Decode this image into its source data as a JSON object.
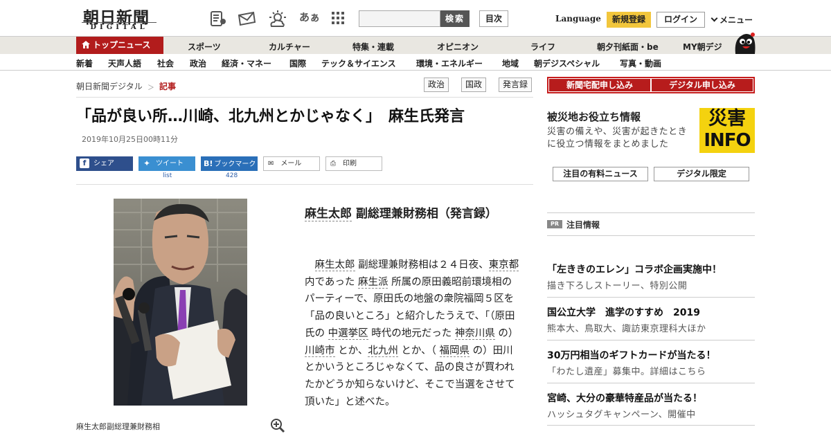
{
  "header": {
    "logo_main": "朝日新聞",
    "logo_sub": "DIGITAL",
    "icons": [
      "newspaper-icon",
      "mail-icon",
      "weather-icon",
      "font-size-icon",
      "grid-menu-icon"
    ],
    "font_size_label": "あぁ",
    "search_placeholder": "",
    "search_button": "検索",
    "toc_button": "目次",
    "language": "Language",
    "register": "新規登録",
    "login": "ログイン",
    "menu": "メニュー"
  },
  "nav1": {
    "top_news": "トップニュース",
    "items": [
      "スポーツ",
      "カルチャー",
      "特集・連載",
      "オピニオン",
      "ライフ",
      "朝夕刊紙面・be",
      "MY朝デジ"
    ]
  },
  "nav2": {
    "items": [
      "新着",
      "天声人語",
      "社会",
      "政治",
      "経済・マネー",
      "国際",
      "テック＆サイエンス",
      "環境・エネルギー",
      "地域",
      "朝デジスペシャル",
      "写真・動画"
    ]
  },
  "breadcrumb": {
    "home": "朝日新聞デジタル",
    "sep": "＞",
    "current": "記事"
  },
  "tags": [
    "政治",
    "国政",
    "発言録"
  ],
  "article": {
    "title": "「品が良い所…川崎、北九州とかじゃなく」　麻生氏発言",
    "date": "2019年10月25日00時11分",
    "share": {
      "facebook": "シェア",
      "twitter": "ツイート",
      "hatena": "ブックマーク",
      "hatena_icon": "B!",
      "mail": "メール",
      "print": "印刷",
      "twitter_count": "list",
      "hatena_count": "428"
    },
    "caption": "麻生太郎副総理兼財務相",
    "lead_name": "麻生太郎",
    "lead_rest": " 副総理兼財務相（発言録）",
    "body": {
      "s1": "麻生太郎",
      "s2": " 副総理兼財務相は２４日夜、",
      "s3": "東京都",
      "s4": " 内であった ",
      "s5": "麻生派",
      "s6": " 所属の原田義昭前環境相のパーティーで、原田氏の地盤の衆院福岡５区を「品の良いところ」と紹介したうえで、「（原田氏の ",
      "s7": "中選挙区",
      "s8": " 時代の地元だった ",
      "s9": "神奈川県",
      "s10": " の） ",
      "s11": "川崎市",
      "s12": " とか、",
      "s13": "北九州",
      "s14": " とか、（ ",
      "s15": "福岡県",
      "s16": " の）田川とかいうところじゃなくて、品の良さが買われたかどうか知らないけど、そこで当選をさせて頂いた」と述べた。"
    }
  },
  "sidebar": {
    "subscribe_paper": "新聞宅配申し込み",
    "subscribe_digital": "デジタル申し込み",
    "disaster_title": "被災地お役立ち情報",
    "disaster_desc": "災害の備えや、災害が起きたときに役立つ情報をまとめました",
    "disaster_badge_top": "災害",
    "disaster_badge_bottom": "INFO",
    "paid_news": "注目の有料ニュース",
    "digital_only": "デジタル限定",
    "pr_tag": "PR",
    "pr_label": "注目情報",
    "pr_items": [
      {
        "title": "「左ききのエレン」コラボ企画実施中！",
        "sub": "描き下ろしストーリー、特別公開"
      },
      {
        "title": "国公立大学　進学のすすめ　2019",
        "sub": "熊本大、鳥取大、諏訪東京理科大ほか"
      },
      {
        "title": "30万円相当のギフトカードが当たる！",
        "sub": "「わたし遺産」募集中。詳細はこちら"
      },
      {
        "title": "宮崎、大分の豪華特産品が当たる！",
        "sub": "ハッシュタグキャンペーン、開催中"
      }
    ]
  },
  "colors": {
    "accent_red": "#b21c1c",
    "register_yellow": "#f2c63c",
    "facebook": "#2e4f8c",
    "twitter": "#3a8fd1",
    "hatena": "#2a6fb8"
  }
}
